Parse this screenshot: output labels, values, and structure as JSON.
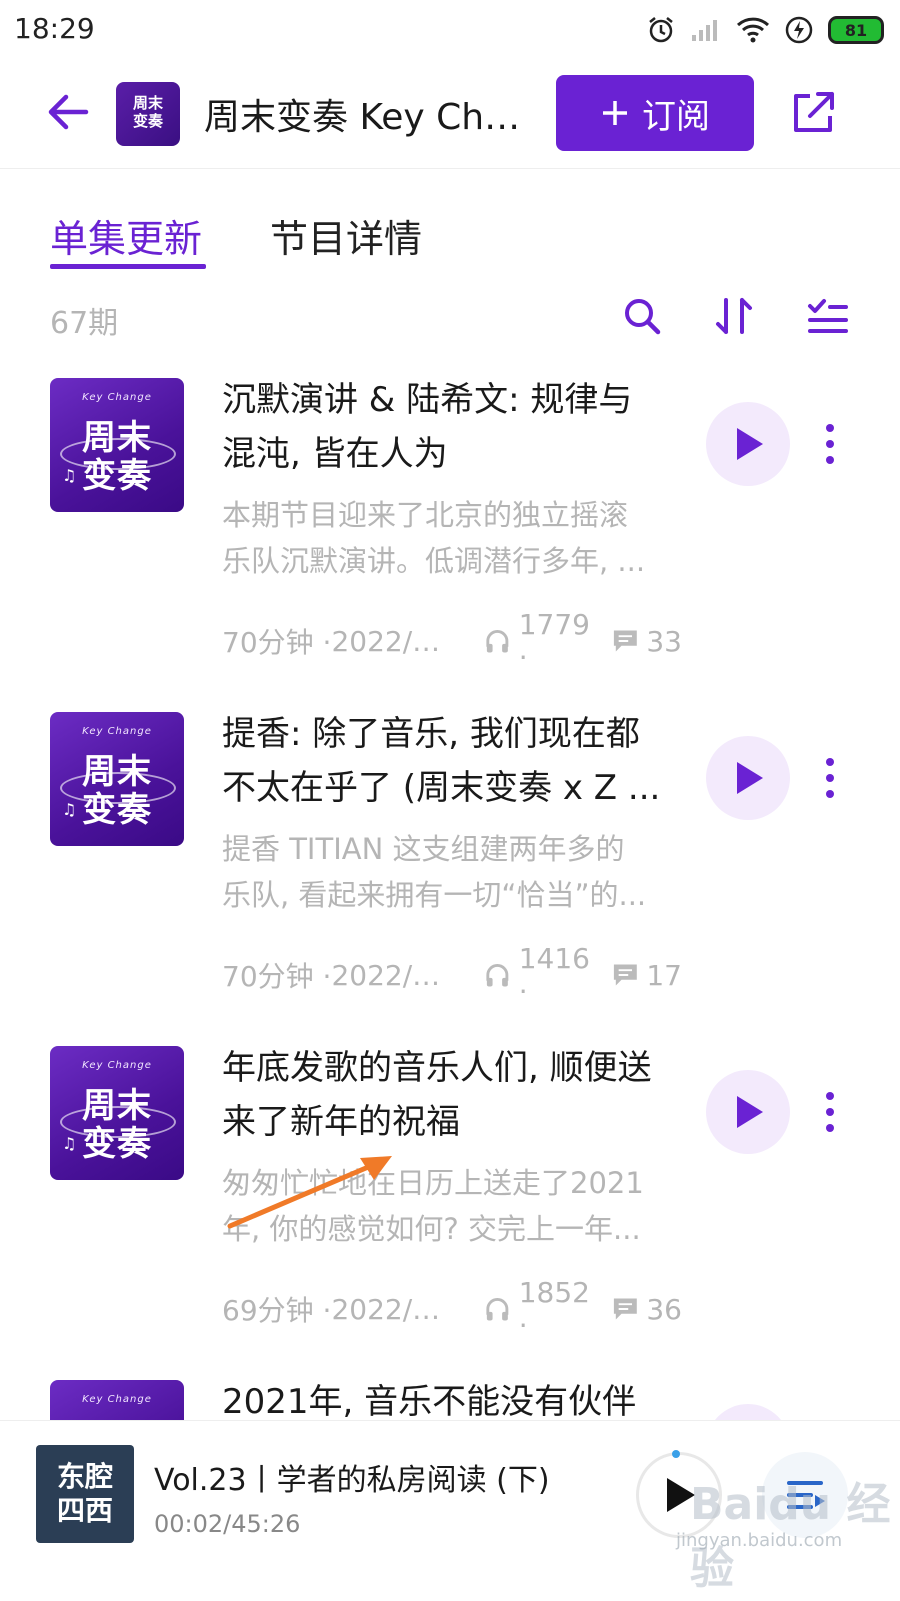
{
  "status_bar": {
    "time": "18:29",
    "battery": "81"
  },
  "header": {
    "title": "周末变奏 Key Change",
    "subscribe_label": "订阅"
  },
  "podcast_cover": {
    "line1": "周末",
    "line2": "变奏",
    "tagline": "Key Change"
  },
  "tabs": [
    {
      "label": "单集更新",
      "active": true
    },
    {
      "label": "节目详情",
      "active": false
    }
  ],
  "episode_count": "67期",
  "episodes": [
    {
      "title_lines": [
        "沉默演讲 & 陆希文: 规律与",
        "混沌, 皆在人为"
      ],
      "desc_lines": [
        "本期节目迎来了北京的独立摇滚",
        "乐队沉默演讲。低调潜行多年, ..."
      ],
      "duration": "70分钟 ·",
      "date": "2022/0...",
      "plays": "1779 ·",
      "comments": "33"
    },
    {
      "title_lines": [
        "提香: 除了音乐, 我们现在都",
        "不太在乎了 (周末变奏 x Z ..."
      ],
      "desc_lines": [
        "提香 TITIAN 这支组建两年多的",
        "乐队, 看起来拥有一切“恰当”的..."
      ],
      "duration": "70分钟 ·",
      "date": "2022/0...",
      "plays": "1416 ·",
      "comments": "17"
    },
    {
      "title_lines": [
        "年底发歌的音乐人们, 顺便送",
        "来了新年的祝福"
      ],
      "desc_lines": [
        "匆匆忙忙地在日历上送走了2021",
        "年, 你的感觉如何? 交完上一年..."
      ],
      "duration": "69分钟 ·",
      "date": "2022/0...",
      "plays": "1852 ·",
      "comments": "36"
    },
    {
      "title_lines": [
        "2021年, 音乐不能没有伙伴"
      ],
      "desc_lines": [],
      "duration": "",
      "date": "",
      "plays": "",
      "comments": ""
    }
  ],
  "player": {
    "cover_line1": "东腔",
    "cover_line2": "四西",
    "title": "Vol.23丨学者的私房阅读 (下)",
    "time": "00:02/45:26"
  },
  "watermark": {
    "text": "Baidu 经验",
    "url": "jingyan.baidu.com"
  },
  "colors": {
    "accent": "#6a22d3",
    "muted": "#b5b5b5",
    "play_bg": "#f3eafc",
    "annotation_arrow": "#f07a28"
  }
}
